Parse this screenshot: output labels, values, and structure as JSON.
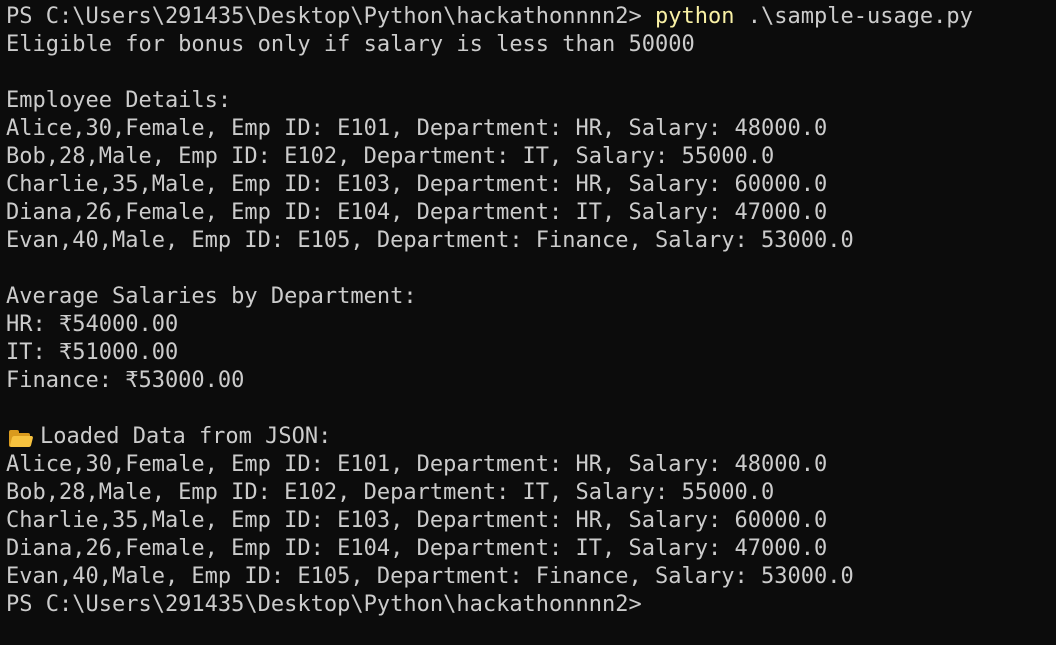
{
  "terminal": {
    "prompt": "PS C:\\Users\\291435\\Desktop\\Python\\hackathonnnn2>",
    "command_exe": "python",
    "command_args": ".\\sample-usage.py",
    "bonus_note": "Eligible for bonus only if salary is less than 50000",
    "employee_header": "Employee Details:",
    "employees": [
      "Alice,30,Female, Emp ID: E101, Department: HR, Salary: 48000.0",
      "Bob,28,Male, Emp ID: E102, Department: IT, Salary: 55000.0",
      "Charlie,35,Male, Emp ID: E103, Department: HR, Salary: 60000.0",
      "Diana,26,Female, Emp ID: E104, Department: IT, Salary: 47000.0",
      "Evan,40,Male, Emp ID: E105, Department: Finance, Salary: 53000.0"
    ],
    "avg_header": "Average Salaries by Department:",
    "averages": [
      "HR: ₹54000.00",
      "IT: ₹51000.00",
      "Finance: ₹53000.00"
    ],
    "json_icon": "folder-icon",
    "json_header": "Loaded Data from JSON:",
    "json_employees": [
      "Alice,30,Female, Emp ID: E101, Department: HR, Salary: 48000.0",
      "Bob,28,Male, Emp ID: E102, Department: IT, Salary: 55000.0",
      "Charlie,35,Male, Emp ID: E103, Department: HR, Salary: 60000.0",
      "Diana,26,Female, Emp ID: E104, Department: IT, Salary: 47000.0",
      "Evan,40,Male, Emp ID: E105, Department: Finance, Salary: 53000.0"
    ],
    "colors": {
      "background": "#0c0c0c",
      "text": "#cccccc",
      "command": "#f9f1a5"
    }
  }
}
